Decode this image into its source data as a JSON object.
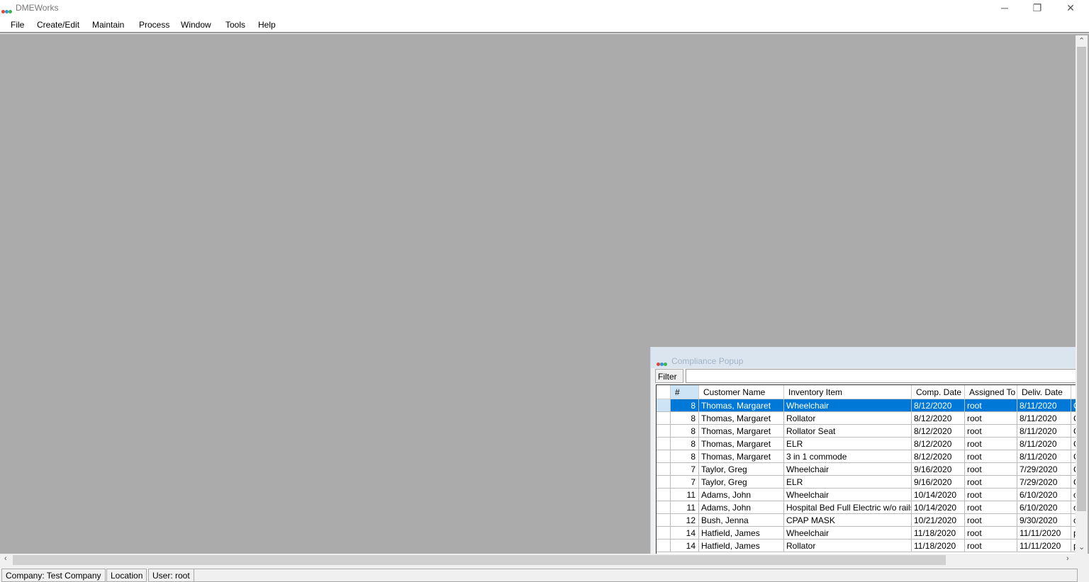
{
  "app": {
    "title": "DMEWorks",
    "logo_colors": [
      "#e0463a",
      "#2a9bd8",
      "#3cb44b"
    ]
  },
  "window_controls": {
    "minimize": "─",
    "restore": "❐",
    "close": "✕"
  },
  "menu": [
    "File",
    "Create/Edit",
    "Maintain",
    "Process",
    "Window",
    "Tools",
    "Help"
  ],
  "status": {
    "company": "Company: Test Company",
    "location": "Location",
    "user": "User: root"
  },
  "popup": {
    "title": "Compliance Popup",
    "filter_label": "Filter :",
    "filter_value": "",
    "columns": [
      "#",
      "Customer Name",
      "Inventory Item",
      "Comp. Date",
      "Assigned To",
      "Deliv. Date",
      ""
    ],
    "rows": [
      [
        "8",
        "Thomas, Margaret",
        "Wheelchair",
        "8/12/2020",
        "root",
        "8/11/2020",
        "C"
      ],
      [
        "8",
        "Thomas, Margaret",
        "Rollator",
        "8/12/2020",
        "root",
        "8/11/2020",
        "C"
      ],
      [
        "8",
        "Thomas, Margaret",
        "Rollator Seat",
        "8/12/2020",
        "root",
        "8/11/2020",
        "C"
      ],
      [
        "8",
        "Thomas, Margaret",
        "ELR",
        "8/12/2020",
        "root",
        "8/11/2020",
        "C"
      ],
      [
        "8",
        "Thomas, Margaret",
        "3 in 1 commode",
        "8/12/2020",
        "root",
        "8/11/2020",
        "C"
      ],
      [
        "7",
        "Taylor, Greg",
        "Wheelchair",
        "9/16/2020",
        "root",
        "7/29/2020",
        "C"
      ],
      [
        "7",
        "Taylor, Greg",
        "ELR",
        "9/16/2020",
        "root",
        "7/29/2020",
        "C"
      ],
      [
        "11",
        "Adams, John",
        "Wheelchair",
        "10/14/2020",
        "root",
        "6/10/2020",
        "c"
      ],
      [
        "11",
        "Adams, John",
        "Hospital Bed Full Electric w/o rails",
        "10/14/2020",
        "root",
        "6/10/2020",
        "c"
      ],
      [
        "12",
        "Bush, Jenna",
        "CPAP MASK",
        "10/21/2020",
        "root",
        "9/30/2020",
        "c"
      ],
      [
        "14",
        "Hatfield, James",
        "Wheelchair",
        "11/18/2020",
        "root",
        "11/11/2020",
        "p"
      ],
      [
        "14",
        "Hatfield, James",
        "Rollator",
        "11/18/2020",
        "root",
        "11/11/2020",
        "p"
      ]
    ],
    "selected_row": 0
  }
}
